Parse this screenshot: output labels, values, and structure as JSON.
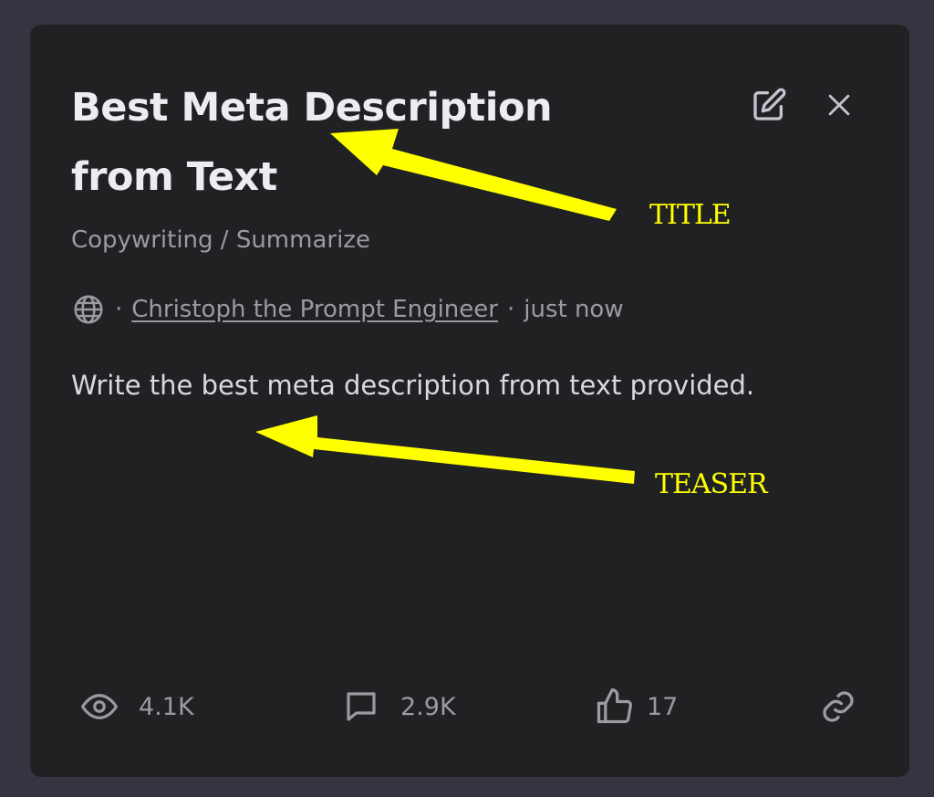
{
  "card": {
    "title": "Best Meta Description from Text",
    "category": "Copywriting / Summarize",
    "author": "Christoph the Prompt Engineer",
    "separator": "·",
    "time": "just now",
    "teaser": "Write the best meta description from text provided.",
    "actions": {
      "edit_icon": "edit-icon",
      "close_icon": "close-icon"
    },
    "stats": {
      "views": "4.1K",
      "comments": "2.9K",
      "likes": "17"
    },
    "icons": {
      "visibility": "globe-icon",
      "views": "eye-icon",
      "comments": "comment-icon",
      "likes": "thumbs-up-icon",
      "link": "link-icon"
    }
  },
  "annotations": {
    "title_label": "TITLE",
    "teaser_label": "TEASER",
    "color": "#ffff00"
  },
  "colors": {
    "page_bg": "#343541",
    "card_bg": "#202123",
    "title": "#ececf1",
    "muted": "#9a9ba3"
  }
}
